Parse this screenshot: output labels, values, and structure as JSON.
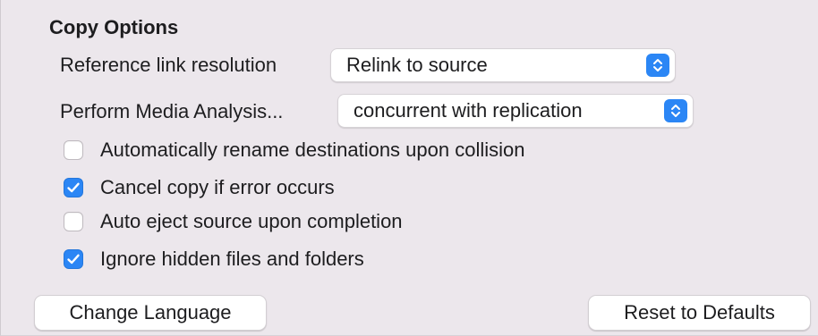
{
  "copy_options": {
    "title": "Copy Options",
    "reference_link": {
      "label": "Reference link resolution",
      "selected": "Relink to source"
    },
    "media_analysis": {
      "label": "Perform Media Analysis...",
      "selected": "concurrent with replication"
    },
    "checkboxes": [
      {
        "label": "Automatically rename destinations upon collision",
        "checked": false
      },
      {
        "label": "Cancel copy if error occurs",
        "checked": true
      },
      {
        "label": "Auto eject source upon completion",
        "checked": false
      },
      {
        "label": "Ignore hidden files and folders",
        "checked": true
      }
    ]
  },
  "buttons": {
    "change_language": "Change Language",
    "reset_defaults": "Reset to Defaults"
  },
  "colors": {
    "accent": "#2b86f5",
    "panel_background": "#ece7ec"
  },
  "icons": {
    "popup_arrows": "up-down-chevron-icon",
    "checkmark": "checkmark-icon"
  }
}
